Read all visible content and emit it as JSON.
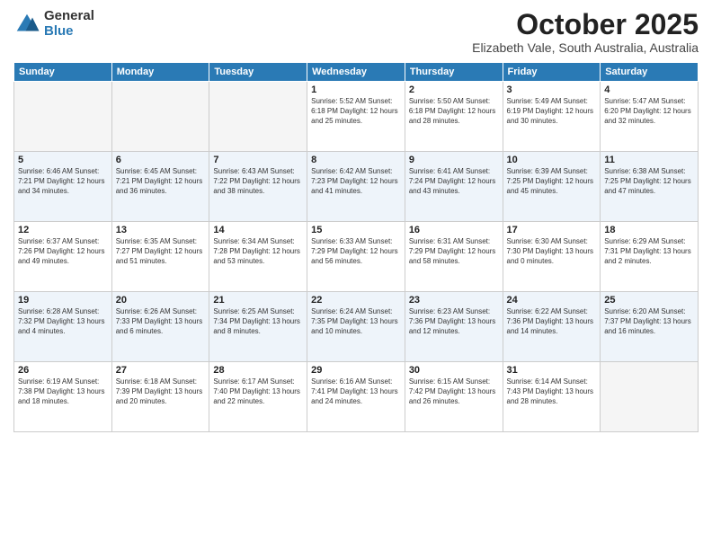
{
  "logo": {
    "general": "General",
    "blue": "Blue"
  },
  "title": "October 2025",
  "subtitle": "Elizabeth Vale, South Australia, Australia",
  "days_of_week": [
    "Sunday",
    "Monday",
    "Tuesday",
    "Wednesday",
    "Thursday",
    "Friday",
    "Saturday"
  ],
  "weeks": [
    [
      {
        "day": "",
        "info": ""
      },
      {
        "day": "",
        "info": ""
      },
      {
        "day": "",
        "info": ""
      },
      {
        "day": "1",
        "info": "Sunrise: 5:52 AM\nSunset: 6:18 PM\nDaylight: 12 hours\nand 25 minutes."
      },
      {
        "day": "2",
        "info": "Sunrise: 5:50 AM\nSunset: 6:18 PM\nDaylight: 12 hours\nand 28 minutes."
      },
      {
        "day": "3",
        "info": "Sunrise: 5:49 AM\nSunset: 6:19 PM\nDaylight: 12 hours\nand 30 minutes."
      },
      {
        "day": "4",
        "info": "Sunrise: 5:47 AM\nSunset: 6:20 PM\nDaylight: 12 hours\nand 32 minutes."
      }
    ],
    [
      {
        "day": "5",
        "info": "Sunrise: 6:46 AM\nSunset: 7:21 PM\nDaylight: 12 hours\nand 34 minutes."
      },
      {
        "day": "6",
        "info": "Sunrise: 6:45 AM\nSunset: 7:21 PM\nDaylight: 12 hours\nand 36 minutes."
      },
      {
        "day": "7",
        "info": "Sunrise: 6:43 AM\nSunset: 7:22 PM\nDaylight: 12 hours\nand 38 minutes."
      },
      {
        "day": "8",
        "info": "Sunrise: 6:42 AM\nSunset: 7:23 PM\nDaylight: 12 hours\nand 41 minutes."
      },
      {
        "day": "9",
        "info": "Sunrise: 6:41 AM\nSunset: 7:24 PM\nDaylight: 12 hours\nand 43 minutes."
      },
      {
        "day": "10",
        "info": "Sunrise: 6:39 AM\nSunset: 7:25 PM\nDaylight: 12 hours\nand 45 minutes."
      },
      {
        "day": "11",
        "info": "Sunrise: 6:38 AM\nSunset: 7:25 PM\nDaylight: 12 hours\nand 47 minutes."
      }
    ],
    [
      {
        "day": "12",
        "info": "Sunrise: 6:37 AM\nSunset: 7:26 PM\nDaylight: 12 hours\nand 49 minutes."
      },
      {
        "day": "13",
        "info": "Sunrise: 6:35 AM\nSunset: 7:27 PM\nDaylight: 12 hours\nand 51 minutes."
      },
      {
        "day": "14",
        "info": "Sunrise: 6:34 AM\nSunset: 7:28 PM\nDaylight: 12 hours\nand 53 minutes."
      },
      {
        "day": "15",
        "info": "Sunrise: 6:33 AM\nSunset: 7:29 PM\nDaylight: 12 hours\nand 56 minutes."
      },
      {
        "day": "16",
        "info": "Sunrise: 6:31 AM\nSunset: 7:29 PM\nDaylight: 12 hours\nand 58 minutes."
      },
      {
        "day": "17",
        "info": "Sunrise: 6:30 AM\nSunset: 7:30 PM\nDaylight: 13 hours\nand 0 minutes."
      },
      {
        "day": "18",
        "info": "Sunrise: 6:29 AM\nSunset: 7:31 PM\nDaylight: 13 hours\nand 2 minutes."
      }
    ],
    [
      {
        "day": "19",
        "info": "Sunrise: 6:28 AM\nSunset: 7:32 PM\nDaylight: 13 hours\nand 4 minutes."
      },
      {
        "day": "20",
        "info": "Sunrise: 6:26 AM\nSunset: 7:33 PM\nDaylight: 13 hours\nand 6 minutes."
      },
      {
        "day": "21",
        "info": "Sunrise: 6:25 AM\nSunset: 7:34 PM\nDaylight: 13 hours\nand 8 minutes."
      },
      {
        "day": "22",
        "info": "Sunrise: 6:24 AM\nSunset: 7:35 PM\nDaylight: 13 hours\nand 10 minutes."
      },
      {
        "day": "23",
        "info": "Sunrise: 6:23 AM\nSunset: 7:36 PM\nDaylight: 13 hours\nand 12 minutes."
      },
      {
        "day": "24",
        "info": "Sunrise: 6:22 AM\nSunset: 7:36 PM\nDaylight: 13 hours\nand 14 minutes."
      },
      {
        "day": "25",
        "info": "Sunrise: 6:20 AM\nSunset: 7:37 PM\nDaylight: 13 hours\nand 16 minutes."
      }
    ],
    [
      {
        "day": "26",
        "info": "Sunrise: 6:19 AM\nSunset: 7:38 PM\nDaylight: 13 hours\nand 18 minutes."
      },
      {
        "day": "27",
        "info": "Sunrise: 6:18 AM\nSunset: 7:39 PM\nDaylight: 13 hours\nand 20 minutes."
      },
      {
        "day": "28",
        "info": "Sunrise: 6:17 AM\nSunset: 7:40 PM\nDaylight: 13 hours\nand 22 minutes."
      },
      {
        "day": "29",
        "info": "Sunrise: 6:16 AM\nSunset: 7:41 PM\nDaylight: 13 hours\nand 24 minutes."
      },
      {
        "day": "30",
        "info": "Sunrise: 6:15 AM\nSunset: 7:42 PM\nDaylight: 13 hours\nand 26 minutes."
      },
      {
        "day": "31",
        "info": "Sunrise: 6:14 AM\nSunset: 7:43 PM\nDaylight: 13 hours\nand 28 minutes."
      },
      {
        "day": "",
        "info": ""
      }
    ]
  ]
}
